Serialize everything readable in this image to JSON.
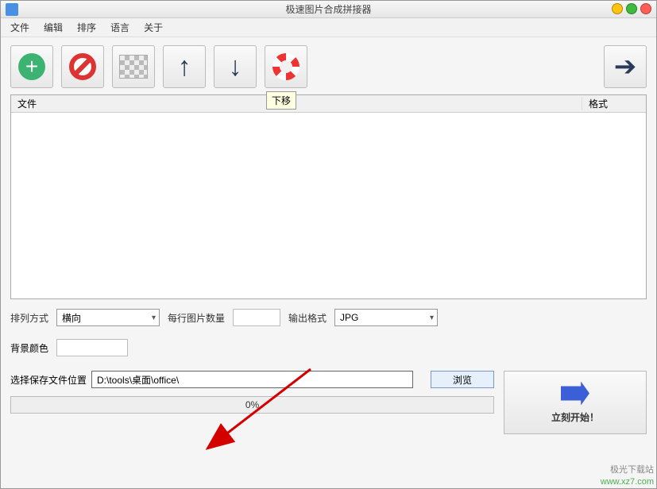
{
  "titlebar": {
    "title": "极速图片合成拼接器"
  },
  "menubar": {
    "items": [
      "文件",
      "编辑",
      "排序",
      "语言",
      "关于"
    ]
  },
  "toolbar": {
    "tooltip": "下移"
  },
  "table": {
    "col_file": "文件",
    "col_format": "格式"
  },
  "settings": {
    "arrange_label": "排列方式",
    "arrange_value": "横向",
    "count_label": "每行图片数量",
    "count_value": "",
    "format_label": "输出格式",
    "format_value": "JPG",
    "bgcolor_label": "背景颜色"
  },
  "save": {
    "label": "选择保存文件位置",
    "path": "D:\\tools\\桌面\\office\\",
    "browse": "浏览"
  },
  "progress": {
    "text": "0%"
  },
  "start": {
    "label": "立刻开始！"
  },
  "watermark": {
    "line1": "极光下载站",
    "line2": "www.xz7.com"
  }
}
